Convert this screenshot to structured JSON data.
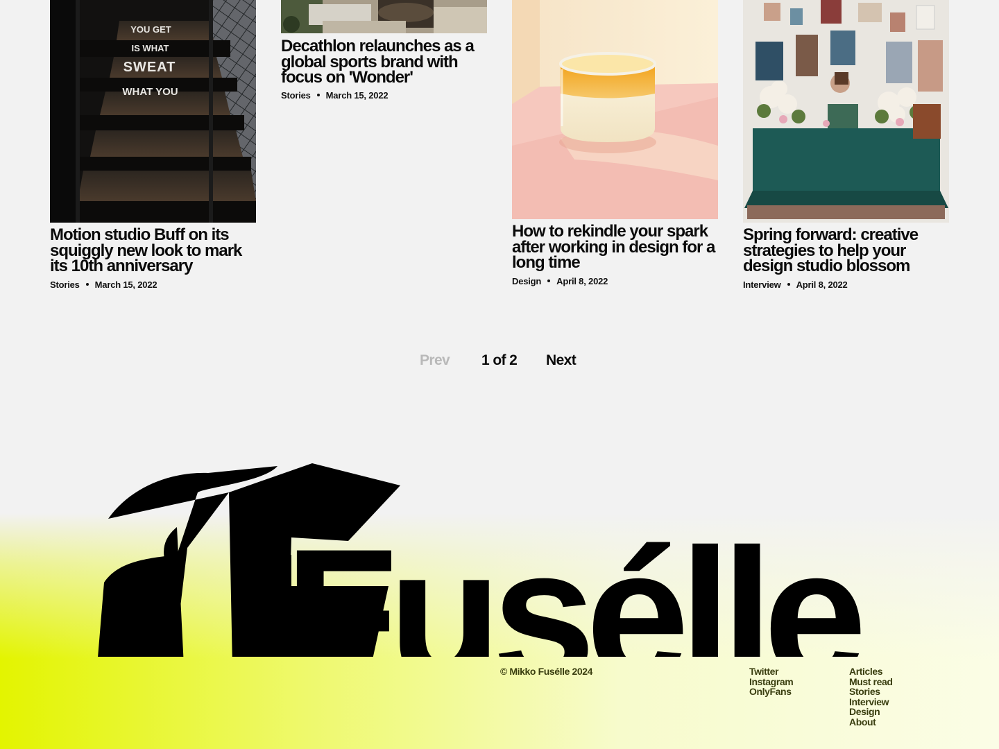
{
  "articles": [
    {
      "title": "Motion studio Buff on its squiggly new look to mark its 10th anniversary",
      "category": "Stories",
      "date": "March 15, 2022",
      "image_text": [
        "YOU GET",
        "IS WHAT",
        "SWEAT",
        "WHAT YOU"
      ]
    },
    {
      "title": "Decathlon relaunches as a global sports brand with focus on 'Wonder'",
      "category": "Stories",
      "date": "March 15, 2022"
    },
    {
      "title": "How to rekindle your spark after working in design for a long time",
      "category": "Design",
      "date": "April 8, 2022"
    },
    {
      "title": "Spring forward: creative strategies to help your design studio blossom",
      "category": "Interview",
      "date": "April 8, 2022"
    }
  ],
  "pagination": {
    "prev": "Prev",
    "current": "1 of 2",
    "next": "Next"
  },
  "footer": {
    "wordmark": "Fusélle",
    "copyright": "© Mikko Fusélle 2024",
    "social": [
      "Twitter",
      "Instagram",
      "OnlyFans"
    ],
    "nav": [
      "Articles",
      "Must read",
      "Stories",
      "Interview",
      "Design",
      "About"
    ]
  },
  "colors": {
    "accent": "#e3f400",
    "text": "#0b0b0b",
    "muted": "#b9b9b9",
    "footer_text": "#3a3e10"
  }
}
